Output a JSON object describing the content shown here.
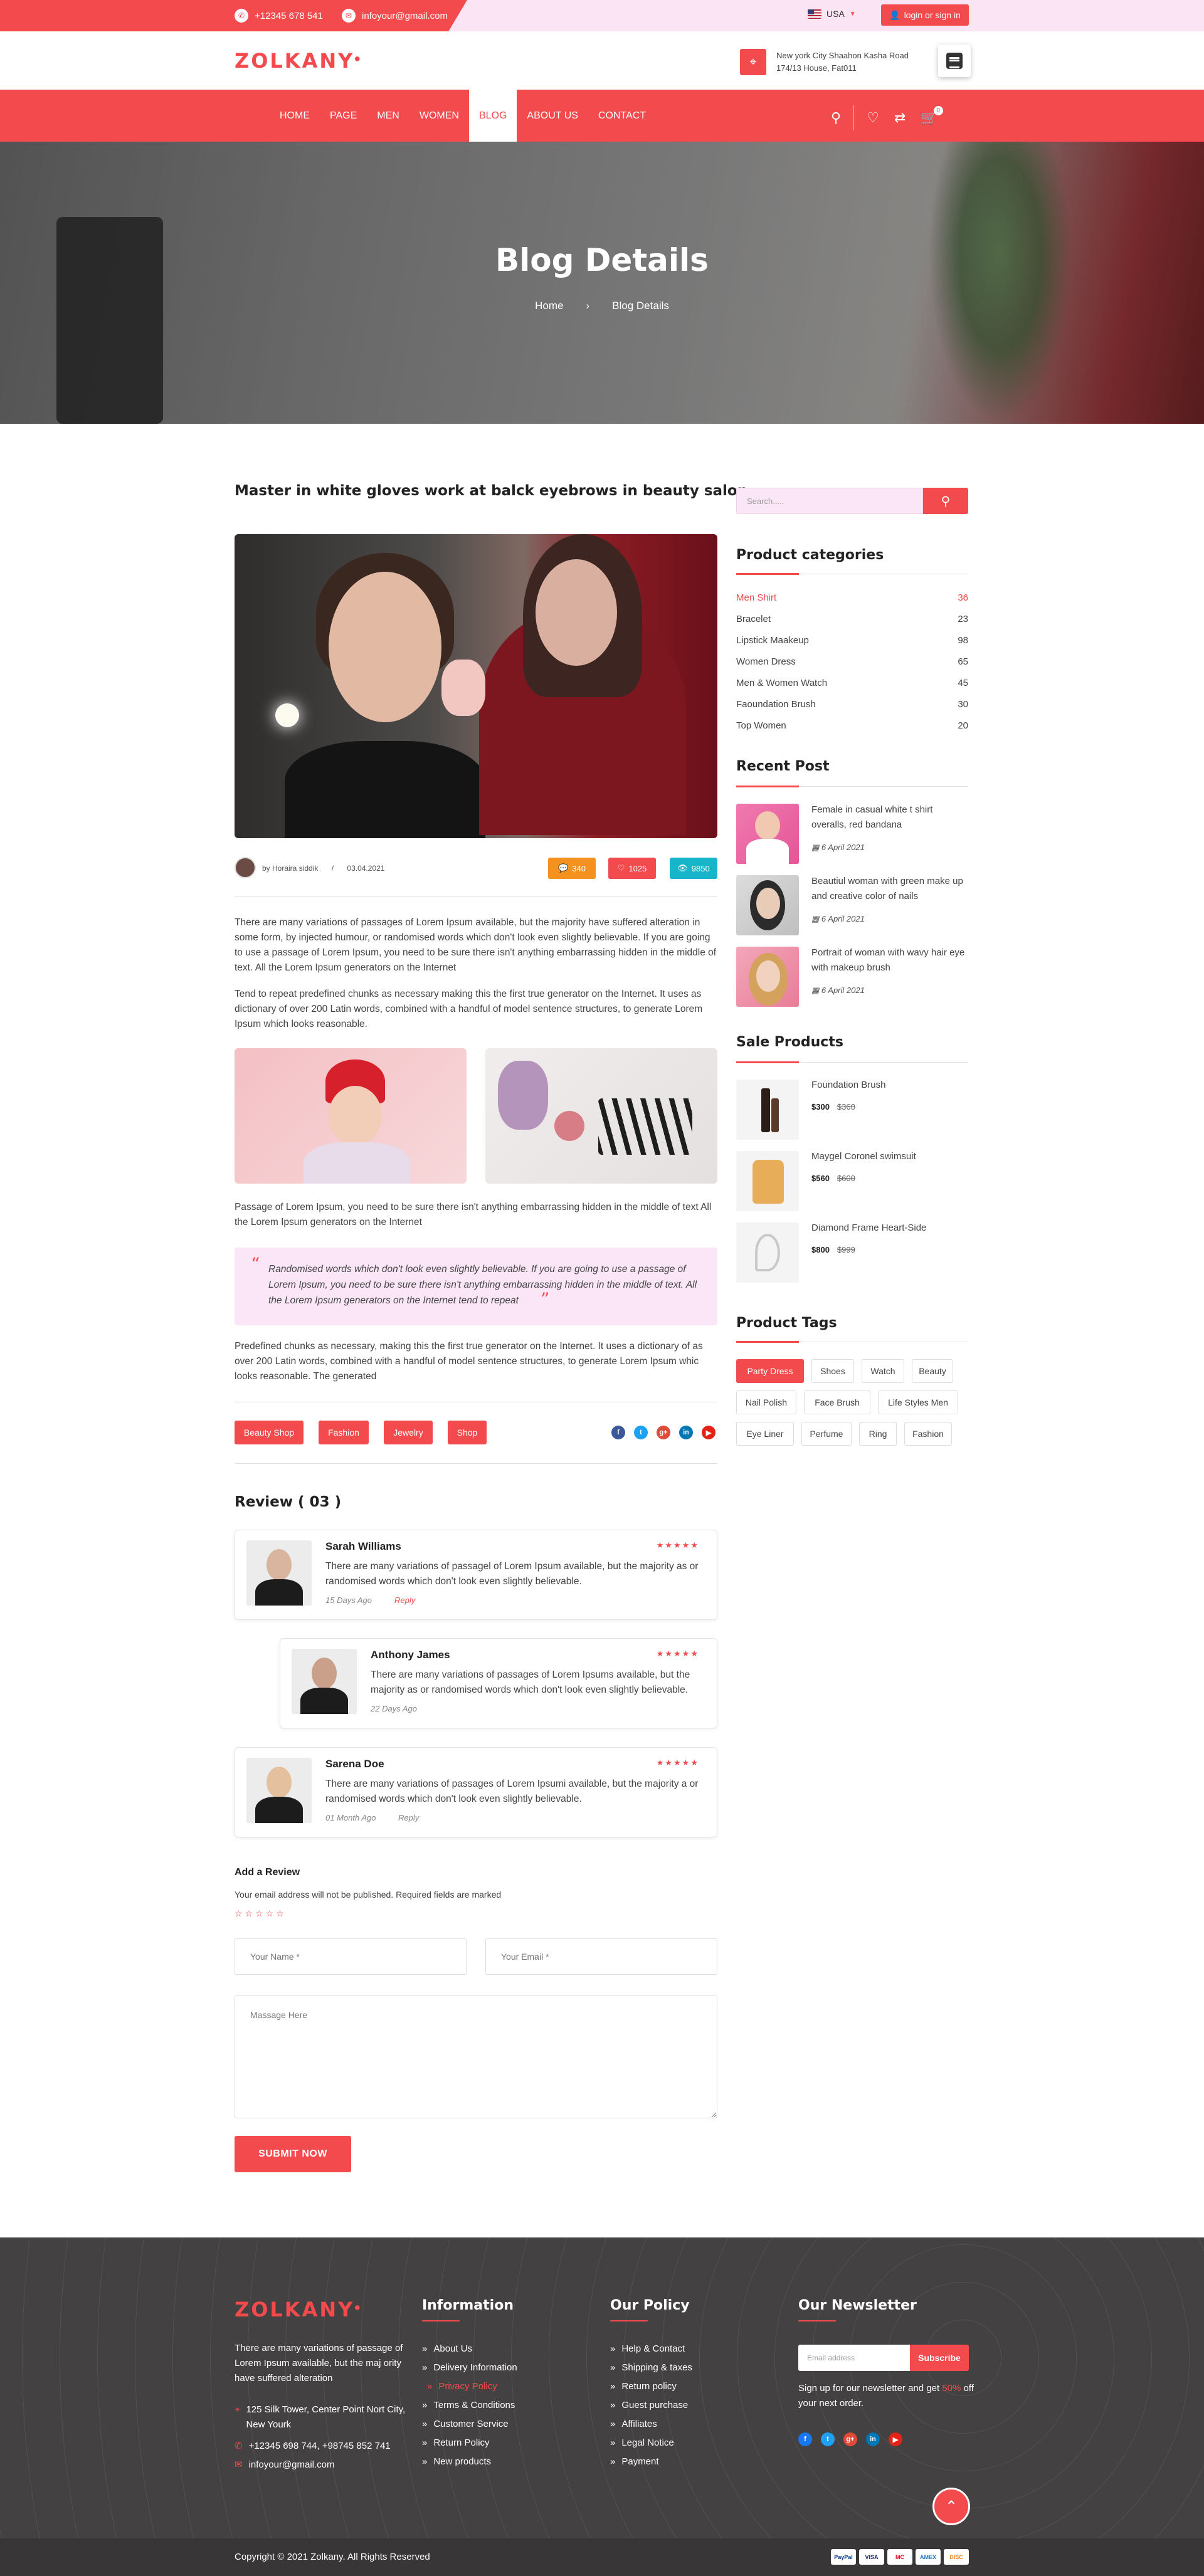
{
  "topbar": {
    "phone": "+12345 678 541",
    "email": "infoyour@gmail.com",
    "lang": "USA",
    "login": "login or sign in"
  },
  "header": {
    "logo": "ZOLKANY",
    "address_line1": "New york City Shaahon Kasha Road",
    "address_line2": "174/13 House, Fat011"
  },
  "nav": {
    "items": [
      "HOME",
      "PAGE",
      "MEN",
      "WOMEN",
      "BLOG",
      "ABOUT US",
      "CONTACT"
    ],
    "active": "BLOG",
    "cart_count": "0"
  },
  "hero": {
    "title": "Blog Details",
    "crumb_home": "Home",
    "crumb_sep": "›",
    "crumb_current": "Blog Details"
  },
  "post": {
    "title": "Master in white gloves work at balck eyebrows in beauty salon",
    "author": "by Horaira siddik",
    "sep": "/",
    "date": "03.04.2021",
    "comments": "340",
    "likes": "1025",
    "views": "9850",
    "p1": "There are many variations of passages of Lorem Ipsum available, but the majority have suffered alteration in some form, by injected humour, or randomised words which don't look even slightly believable. If you are going to use a passage of Lorem Ipsum, you need to be sure there isn't anything embarrassing hidden in the middle of text. All the Lorem Ipsum generators on the Internet",
    "p2": "Tend to repeat predefined chunks as necessary making this the first true generator on the Internet. It uses as dictionary of over 200 Latin words, combined with a handful of model sentence structures, to generate Lorem Ipsum which looks reasonable.",
    "p3": "Passage of Lorem Ipsum, you need to be sure there isn't anything embarrassing hidden in the middle of text All the Lorem Ipsum generators on the Internet",
    "quote": "Randomised words which don't look even slightly believable. If you are going to use a passage of Lorem Ipsum, you need to be sure there isn't anything embarrassing hidden in the middle of text. All the Lorem Ipsum generators on the Internet tend to repeat",
    "p4": "Predefined chunks as necessary, making this the first true generator on the Internet. It uses a dictionary of as over 200 Latin words, combined with a handful of model sentence structures, to generate Lorem Ipsum whic looks reasonable. The generated",
    "tags": [
      "Beauty Shop",
      "Fashion",
      "Jewelry",
      "Shop"
    ],
    "social": [
      "f",
      "t",
      "g+",
      "in",
      "▶"
    ]
  },
  "reviews": {
    "heading": "Review ( 03 )",
    "stars": "★★★★★",
    "items": [
      {
        "name": "Sarah Williams",
        "text": "There are many variations of passagel of Lorem Ipsum available, but the majority as or randomised words which don't look even slightly believable.",
        "date": "15 Days Ago",
        "reply": "Reply"
      },
      {
        "name": "Anthony James",
        "text": "There are many variations of passages of Lorem Ipsums available, but the majority as or randomised words which don't look even slightly believable.",
        "date": "22 Days Ago",
        "reply": ""
      },
      {
        "name": "Sarena Doe",
        "text": "There are many variations of passages of Lorem Ipsumi available, but the majority a or randomised words which don't look even slightly believable.",
        "date": "01 Month Ago",
        "reply": "Reply"
      }
    ]
  },
  "add_review": {
    "heading": "Add a Review",
    "note": "Your email address will not be published. Required fields are marked",
    "stars": "☆☆☆☆☆",
    "name_ph": "Your Name *",
    "email_ph": "Your Email *",
    "msg_ph": "Massage Here",
    "submit": "SUBMIT NOW"
  },
  "sidebar": {
    "search_ph": "Search.....",
    "categories_h": "Product categories",
    "categories": [
      {
        "name": "Men Shirt",
        "count": "36"
      },
      {
        "name": "Bracelet",
        "count": "23"
      },
      {
        "name": "Lipstick Maakeup",
        "count": "98"
      },
      {
        "name": "Women Dress",
        "count": "65"
      },
      {
        "name": "Men & Women Watch",
        "count": "45"
      },
      {
        "name": "Faoundation Brush",
        "count": "30"
      },
      {
        "name": "Top Women",
        "count": "20"
      }
    ],
    "recent_h": "Recent Post",
    "recent": [
      {
        "title": "Female in casual white t shirt overalls, red bandana",
        "date": "6 April 2021"
      },
      {
        "title": "Beautiul woman with green make up and creative color of nails",
        "date": "6 April 2021"
      },
      {
        "title": "Portrait of woman with wavy hair eye with makeup brush",
        "date": "6 April 2021"
      }
    ],
    "sale_h": "Sale Products",
    "sale": [
      {
        "name": "Foundation Brush",
        "price": "$300",
        "old": "$360"
      },
      {
        "name": "Maygel Coronel swimsuit",
        "price": "$560",
        "old": "$600"
      },
      {
        "name": "Diamond Frame Heart-Side",
        "price": "$800",
        "old": "$999"
      }
    ],
    "tags_h": "Product Tags",
    "tags": [
      "Party Dress",
      "Shoes",
      "Watch",
      "Beauty",
      "Nail Polish",
      "Face Brush",
      "Life Styles Men",
      "Eye Liner",
      "Perfume",
      "Ring",
      "Fashion"
    ]
  },
  "footer": {
    "logo": "ZOLKANY",
    "about": "There are many variations of passage of Lorem Ipsum available, but the maj ority have suffered alteration",
    "address": "125 Silk Tower, Center Point Nort City, New Yourk",
    "phones": "+12345 698 744, +98745 852 741",
    "email": "infoyour@gmail.com",
    "info_h": "Information",
    "info": [
      "About Us",
      "Delivery Information",
      "Privacy Policy",
      "Terms & Conditions",
      "Customer Service",
      "Return Policy",
      "New products"
    ],
    "policy_h": "Our Policy",
    "policy": [
      "Help & Contact",
      "Shipping & taxes",
      "Return policy",
      "Guest purchase",
      "Affiliates",
      "Legal Notice",
      "Payment"
    ],
    "news_h": "Our Newsletter",
    "news_ph": "Email address",
    "news_btn": "Subscribe",
    "news_note1": "Sign up for our newsletter and get",
    "news_pct": "50%",
    "news_note2": "off your next order.",
    "copyright": "Copyright © 2021 Zolkany. All Rights Reserved",
    "payments": [
      "PayPal",
      "VISA",
      "MC",
      "AMEX",
      "DISC"
    ]
  }
}
